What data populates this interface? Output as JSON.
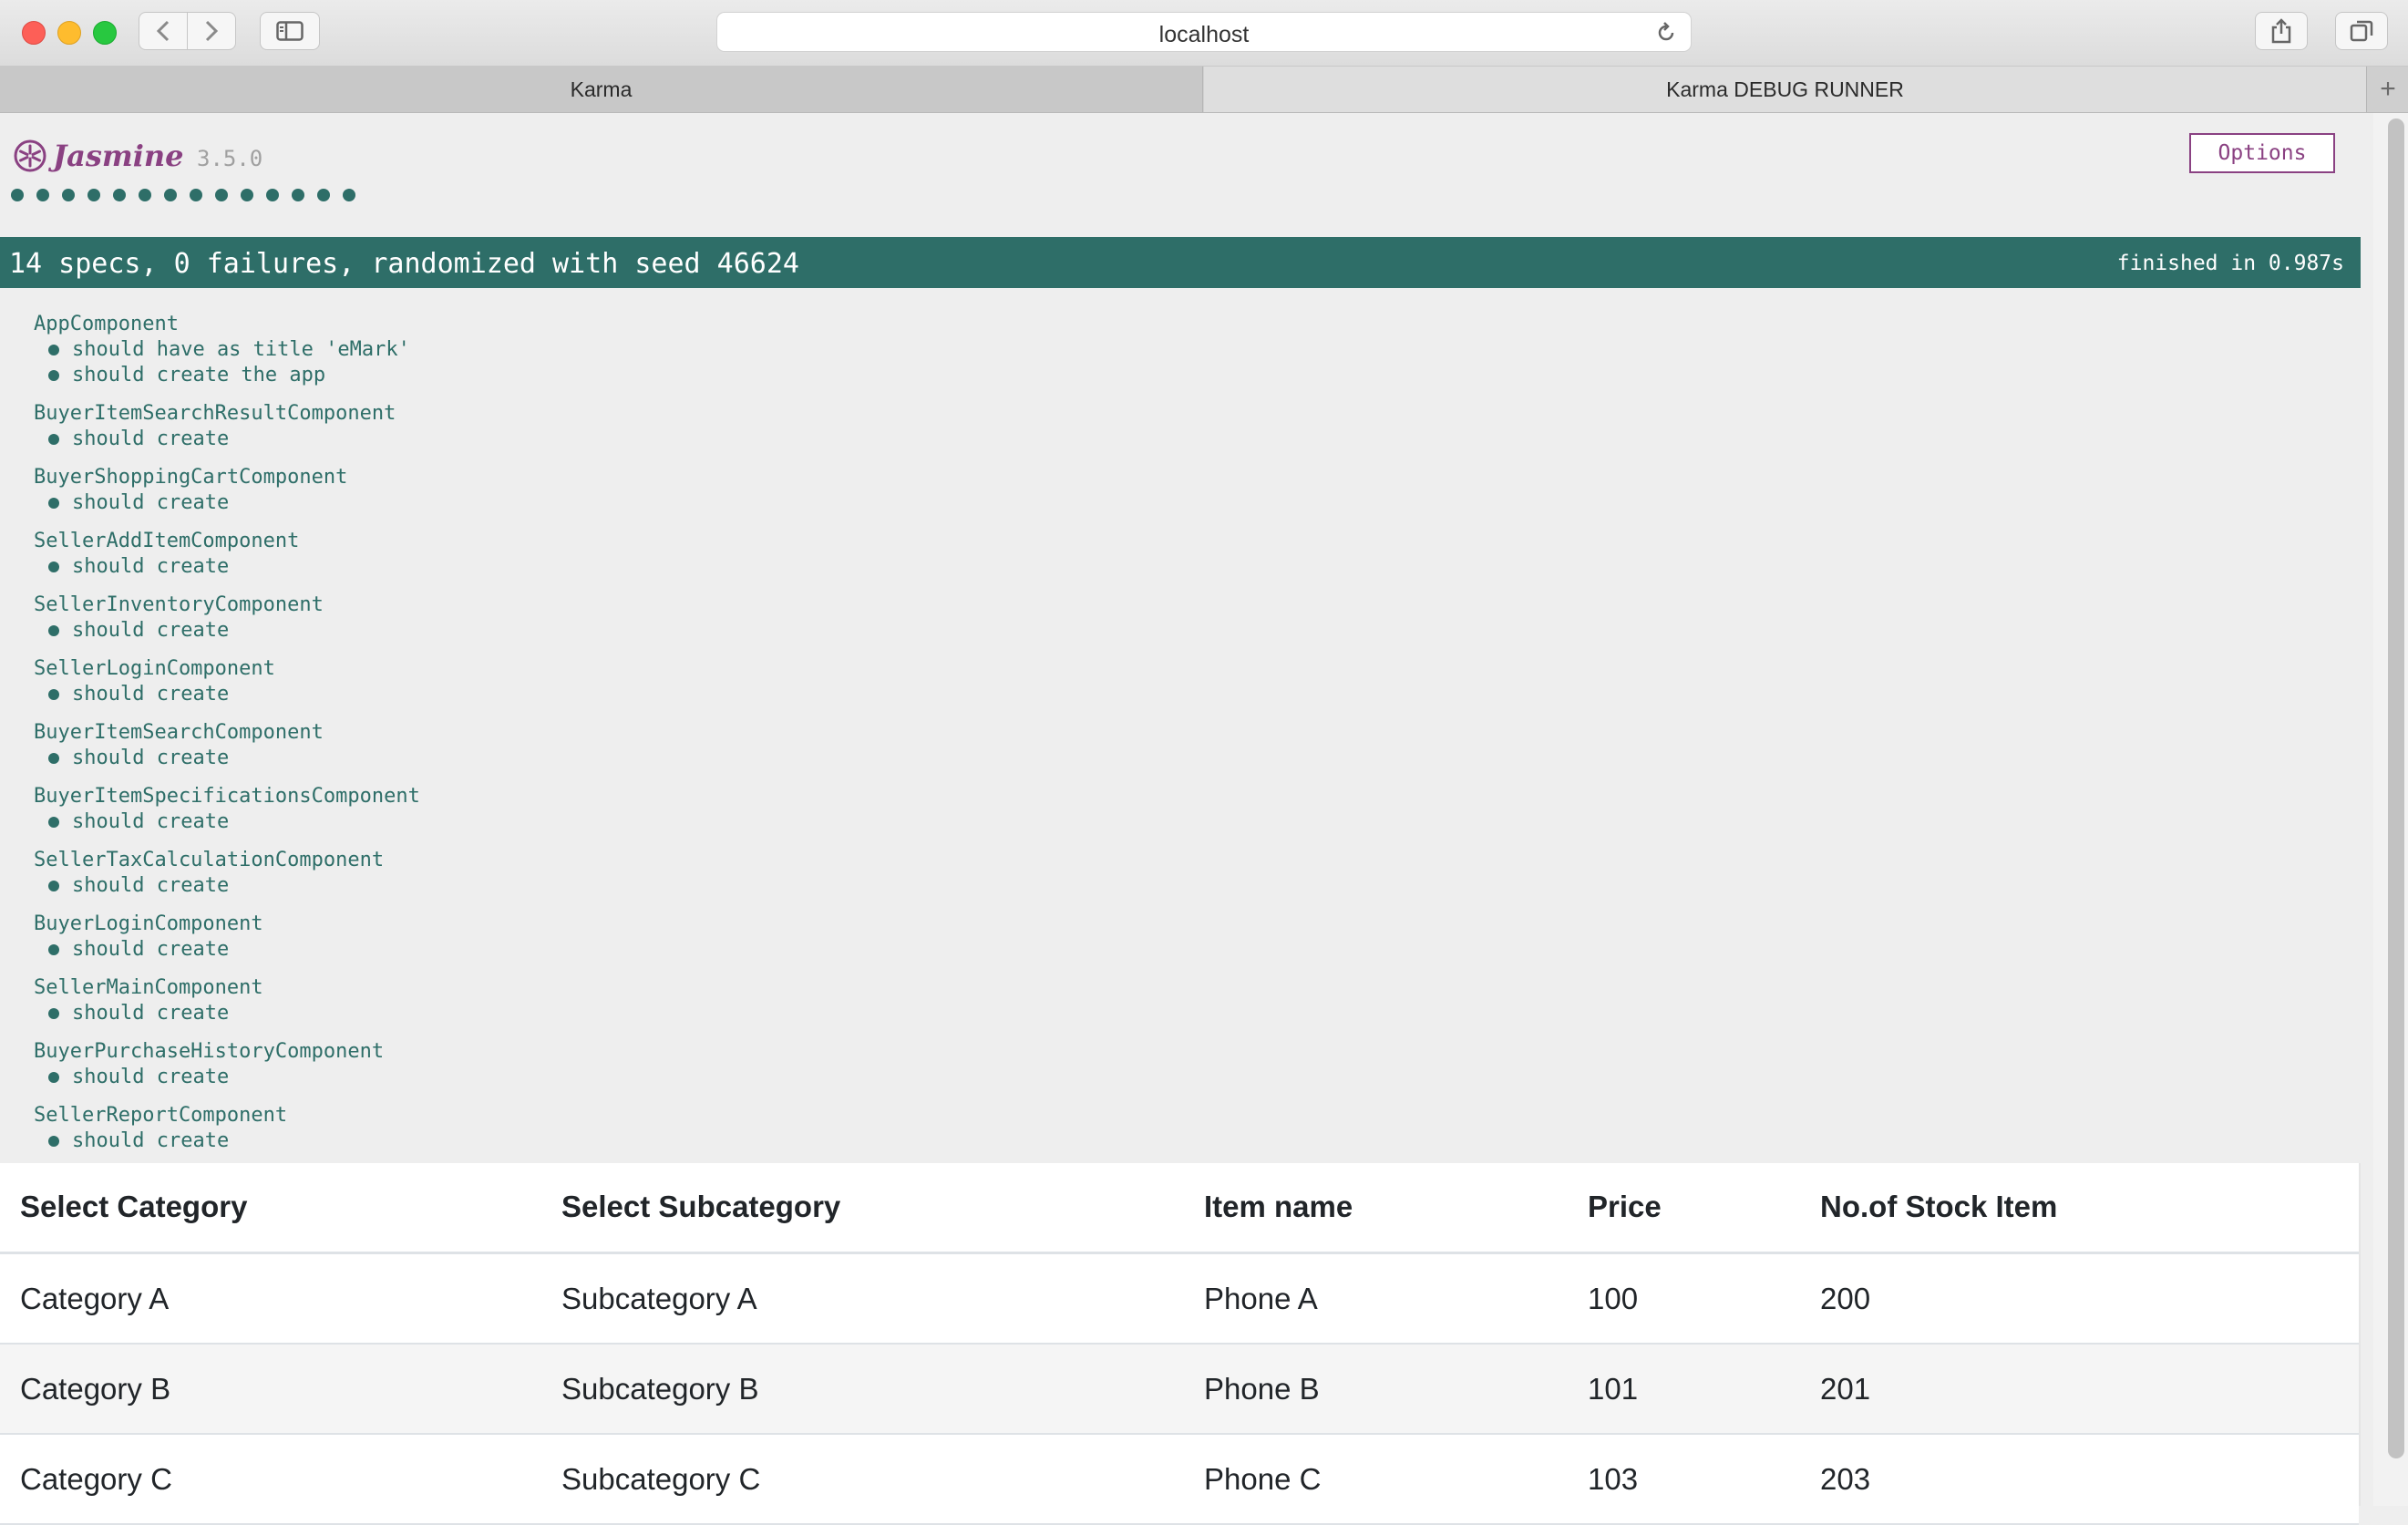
{
  "browser": {
    "url": "localhost",
    "tabs": [
      "Karma",
      "Karma DEBUG RUNNER"
    ],
    "new_tab_label": "+"
  },
  "jasmine": {
    "logo_text": "Jasmine",
    "version": "3.5.0",
    "options_label": "Options",
    "spec_dot_count": 14,
    "summary": "14 specs, 0 failures, randomized with seed 46624",
    "finished": "finished in 0.987s",
    "suites": [
      {
        "name": "AppComponent",
        "specs": [
          "should have as title 'eMark'",
          "should create the app"
        ]
      },
      {
        "name": "BuyerItemSearchResultComponent",
        "specs": [
          "should create"
        ]
      },
      {
        "name": "BuyerShoppingCartComponent",
        "specs": [
          "should create"
        ]
      },
      {
        "name": "SellerAddItemComponent",
        "specs": [
          "should create"
        ]
      },
      {
        "name": "SellerInventoryComponent",
        "specs": [
          "should create"
        ]
      },
      {
        "name": "SellerLoginComponent",
        "specs": [
          "should create"
        ]
      },
      {
        "name": "BuyerItemSearchComponent",
        "specs": [
          "should create"
        ]
      },
      {
        "name": "BuyerItemSpecificationsComponent",
        "specs": [
          "should create"
        ]
      },
      {
        "name": "SellerTaxCalculationComponent",
        "specs": [
          "should create"
        ]
      },
      {
        "name": "BuyerLoginComponent",
        "specs": [
          "should create"
        ]
      },
      {
        "name": "SellerMainComponent",
        "specs": [
          "should create"
        ]
      },
      {
        "name": "BuyerPurchaseHistoryComponent",
        "specs": [
          "should create"
        ]
      },
      {
        "name": "SellerReportComponent",
        "specs": [
          "should create"
        ]
      }
    ],
    "colors": {
      "pass": "#2e6e68",
      "brand": "#8a4182"
    }
  },
  "table": {
    "headers": [
      "Select Category",
      "Select Subcategory",
      "Item name",
      "Price",
      "No.of Stock Item"
    ],
    "rows": [
      [
        "Category A",
        "Subcategory A",
        "Phone A",
        "100",
        "200"
      ],
      [
        "Category B",
        "Subcategory B",
        "Phone B",
        "101",
        "201"
      ],
      [
        "Category C",
        "Subcategory C",
        "Phone C",
        "103",
        "203"
      ]
    ]
  }
}
